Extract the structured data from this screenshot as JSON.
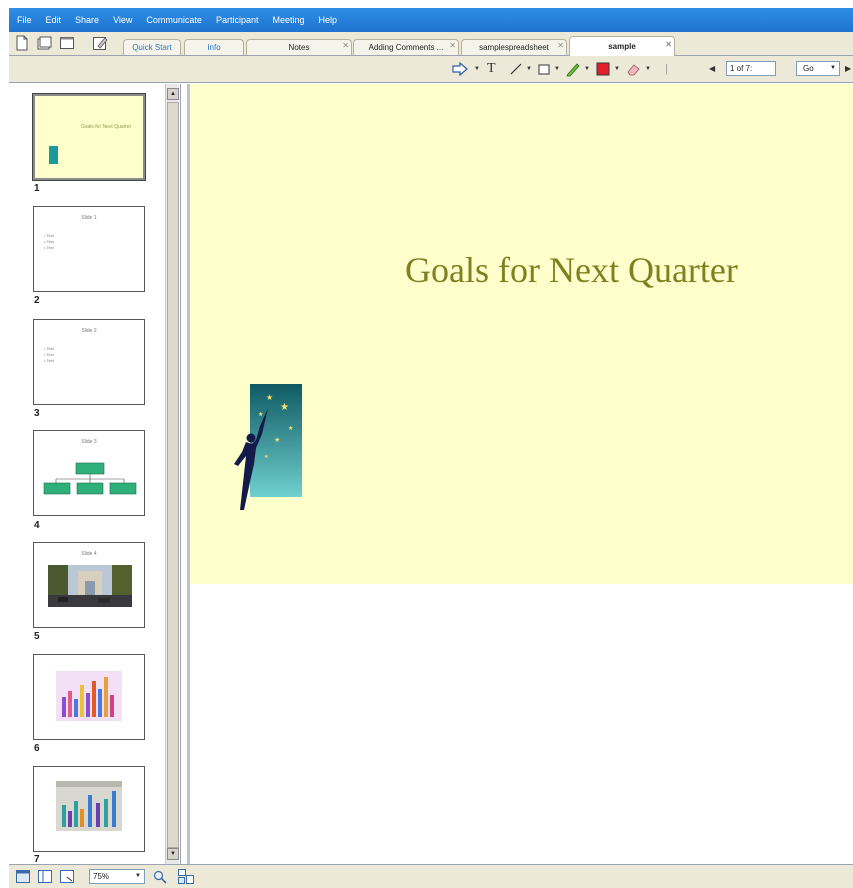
{
  "menu": {
    "items": [
      "File",
      "Edit",
      "Share",
      "View",
      "Communicate",
      "Participant",
      "Meeting",
      "Help"
    ]
  },
  "tabs": [
    {
      "label": "Quick Start"
    },
    {
      "label": "Info"
    },
    {
      "label": "Notes"
    },
    {
      "label": "Adding Comments ..."
    },
    {
      "label": "samplespreadsheet"
    },
    {
      "label": "sample"
    }
  ],
  "toolbar": {
    "text_tool": "T",
    "page_field": "1 of 7:",
    "go_label": "Go"
  },
  "thumbnails": [
    {
      "number": "1",
      "title": "Goals for Next Quarter"
    },
    {
      "number": "2",
      "title": "Slide 1",
      "bullets": [
        "Text",
        "Text",
        "Text"
      ]
    },
    {
      "number": "3",
      "title": "Slide 2",
      "bullets": [
        "Text",
        "Text",
        "Text"
      ]
    },
    {
      "number": "4",
      "title": "Slide 3"
    },
    {
      "number": "5",
      "title": "Slide 4"
    },
    {
      "number": "6",
      "title": ""
    },
    {
      "number": "7",
      "title": ""
    }
  ],
  "slide": {
    "title": "Goals for Next Quarter",
    "background": "#ffffcc",
    "title_color": "#808020"
  },
  "status": {
    "zoom": "75%"
  },
  "colors": {
    "menubar": "#1e74d0",
    "chrome": "#ece9d8",
    "pen_red": "#e0202a"
  }
}
